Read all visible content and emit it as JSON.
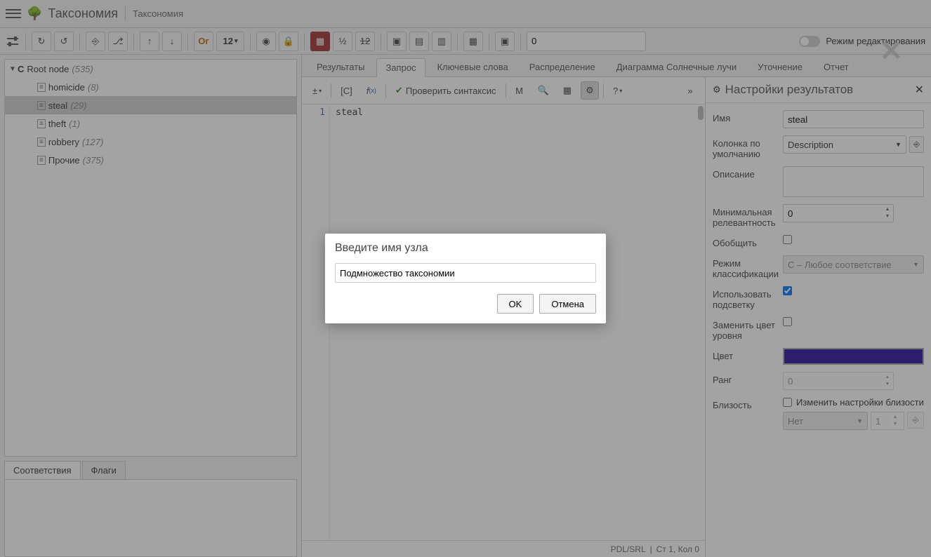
{
  "header": {
    "title": "Таксономия",
    "breadcrumb": "Таксономия"
  },
  "toolbar": {
    "or_label": "Oг",
    "num_display": "12",
    "num_input_value": "0",
    "edit_mode_label": "Режим редактирования"
  },
  "tree": {
    "root": {
      "type": "C",
      "label": "Root node",
      "count": "(535)"
    },
    "items": [
      {
        "label": "homicide",
        "count": "(8)"
      },
      {
        "label": "steal",
        "count": "(29)"
      },
      {
        "label": "theft",
        "count": "(1)"
      },
      {
        "label": "robbery",
        "count": "(127)"
      },
      {
        "label": "Прочие",
        "count": "(375)"
      }
    ]
  },
  "bottom_tabs": {
    "matches": "Соответствия",
    "flags": "Флаги"
  },
  "right_tabs": {
    "results": "Результаты",
    "query": "Запрос",
    "keywords": "Ключевые слова",
    "distribution": "Распределение",
    "sunburst": "Диаграмма Солнечные лучи",
    "refine": "Уточнение",
    "report": "Отчет"
  },
  "editor_toolbar": {
    "pm": "±",
    "c_bracket": "[C]",
    "fx": "f(x)",
    "check_syntax": "Проверить синтаксис",
    "m": "M",
    "help": "?"
  },
  "editor": {
    "line_number": "1",
    "code": "steal"
  },
  "status_bar": {
    "mode": "PDL/SRL",
    "position": "Ст 1, Кол 0"
  },
  "settings": {
    "title": "Настройки результатов",
    "labels": {
      "name": "Имя",
      "default_column": "Колонка по умолчанию",
      "description": "Описание",
      "min_relevance": "Минимальная релевантность",
      "generalize": "Обобщить",
      "classification_mode": "Режим классификации",
      "use_highlight": "Использовать подсветку",
      "replace_level_color": "Заменить цвет уровня",
      "color": "Цвет",
      "rank": "Ранг",
      "proximity": "Близость",
      "change_proximity": "Изменить настройки близости",
      "proximity_mode": "Нет",
      "proximity_value": "1"
    },
    "values": {
      "name": "steal",
      "default_column": "Description",
      "min_relevance": "0",
      "classification_mode": "C – Любое соответствие",
      "rank": "0",
      "color": "#2a0d9e"
    }
  },
  "modal": {
    "title": "Введите имя узла",
    "value": "Подмножество таксономии",
    "ok": "OK",
    "cancel": "Отмена"
  }
}
